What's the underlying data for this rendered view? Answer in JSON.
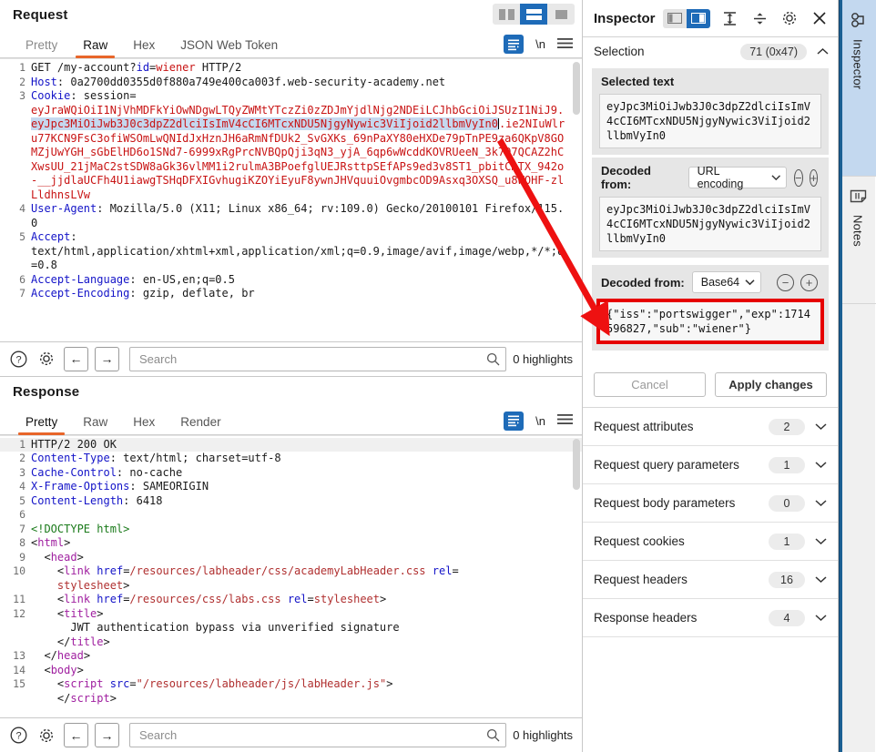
{
  "request": {
    "title": "Request",
    "tabs": [
      {
        "label": "Pretty",
        "active": false
      },
      {
        "label": "Raw",
        "active": true
      },
      {
        "label": "Hex",
        "active": false
      },
      {
        "label": "JSON Web Token",
        "active": false
      }
    ],
    "layout_buttons": [
      "split-vertical",
      "split-horizontal",
      "single-pane"
    ],
    "layout_selected": "split-horizontal",
    "icons": [
      "word-wrap-icon",
      "newline-icon",
      "menu-icon"
    ],
    "newline_label": "\\n",
    "lines": [
      {
        "n": "1",
        "parts": [
          {
            "t": "GET /my-account?",
            "c": ""
          },
          {
            "t": "id",
            "c": "blue"
          },
          {
            "t": "=",
            "c": ""
          },
          {
            "t": "wiener",
            "c": "red"
          },
          {
            "t": " HTTP/2",
            "c": ""
          }
        ]
      },
      {
        "n": "2",
        "parts": [
          {
            "t": "Host",
            "c": "blue"
          },
          {
            "t": ": 0a2700dd0355d0f880a749e400ca003f.web-security-academy.net",
            "c": ""
          }
        ]
      },
      {
        "n": "3",
        "parts": [
          {
            "t": "Cookie",
            "c": "blue"
          },
          {
            "t": ": session=\n",
            "c": ""
          },
          {
            "t": "eyJraWQiOiI1NjVhMDFkYiOwNDgwLTQyZWMtYTczZi0zZDJmYjdlNjg2NDEiLCJhbGciOiJSUzI1NiJ9.",
            "c": "red"
          },
          {
            "t": "eyJpc3MiOiJwb3J0c3dpZ2dlciIsImV4cCI6MTcxNDU5NjgyNywic3ViIjoid2llbmVyIn0",
            "c": "red hl"
          },
          {
            "t": "CARET",
            "c": "caret"
          },
          {
            "t": ".ie2NIuWlru77KCN9FsC3ofiWSOmLwQNIdJxHznJH6aRmNfDUk2_SvGXKs_69nPaXY80eHXDe79pTnPE9za6QKpV8GOMZjUwYGH_sGbElHD6o1SNd7-6999xRgPrcNVBQpQji3qN3_yjA_6qp6wWcddKOVRUeeN_3k7O7QCAZ2hCXwsUU_21jMaC2stSDW8aGk36vlMM1i2rulmA3BPoefglUEJRsttpSEfAPs9ed3v8ST1_pbitCmTX_942o-__jjdlaUCFh4U1iawgTSHqDFXIGvhugiKZOYiEyuF8ywnJHVquuiOvgmbcOD9Asxq3OXSQ_u8WOHF-zlLldhnsLVw",
            "c": "red"
          }
        ]
      },
      {
        "n": "4",
        "parts": [
          {
            "t": "User-Agent",
            "c": "blue"
          },
          {
            "t": ": Mozilla/5.0 (X11; Linux x86_64; rv:109.0) Gecko/20100101 Firefox/115.0",
            "c": ""
          }
        ]
      },
      {
        "n": "5",
        "parts": [
          {
            "t": "Accept",
            "c": "blue"
          },
          {
            "t": ": \ntext/html,application/xhtml+xml,application/xml;q=0.9,image/avif,image/webp,*/*;q=0.8",
            "c": ""
          }
        ]
      },
      {
        "n": "6",
        "parts": [
          {
            "t": "Accept-Language",
            "c": "blue"
          },
          {
            "t": ": en-US,en;q=0.5",
            "c": ""
          }
        ]
      },
      {
        "n": "7",
        "parts": [
          {
            "t": "Accept-Encoding",
            "c": "blue"
          },
          {
            "t": ": gzip, deflate, br",
            "c": ""
          }
        ]
      }
    ],
    "findbar": {
      "search_placeholder": "Search",
      "search_value": "",
      "highlights": "0 highlights",
      "icons": [
        "help-icon",
        "gear-icon",
        "prev-icon",
        "next-icon",
        "search-icon"
      ]
    }
  },
  "response": {
    "title": "Response",
    "tabs": [
      {
        "label": "Pretty",
        "active": true
      },
      {
        "label": "Raw",
        "active": false
      },
      {
        "label": "Hex",
        "active": false
      },
      {
        "label": "Render",
        "active": false
      }
    ],
    "newline_label": "\\n",
    "lines": [
      {
        "n": "1",
        "first": true,
        "parts": [
          {
            "t": "HTTP/2 200 OK",
            "c": ""
          }
        ]
      },
      {
        "n": "2",
        "parts": [
          {
            "t": "Content-Type",
            "c": "blue"
          },
          {
            "t": ": text/html; charset=utf-8",
            "c": ""
          }
        ]
      },
      {
        "n": "3",
        "parts": [
          {
            "t": "Cache-Control",
            "c": "blue"
          },
          {
            "t": ": no-cache",
            "c": ""
          }
        ]
      },
      {
        "n": "4",
        "parts": [
          {
            "t": "X-Frame-Options",
            "c": "blue"
          },
          {
            "t": ": SAMEORIGIN",
            "c": ""
          }
        ]
      },
      {
        "n": "5",
        "parts": [
          {
            "t": "Content-Length",
            "c": "blue"
          },
          {
            "t": ": 6418",
            "c": ""
          }
        ]
      },
      {
        "n": "6",
        "parts": [
          {
            "t": "",
            "c": ""
          }
        ]
      },
      {
        "n": "7",
        "parts": [
          {
            "t": "<!DOCTYPE html>",
            "c": "grn"
          }
        ]
      },
      {
        "n": "8",
        "parts": [
          {
            "t": "<",
            "c": ""
          },
          {
            "t": "html",
            "c": "pur"
          },
          {
            "t": ">",
            "c": ""
          }
        ]
      },
      {
        "n": "9",
        "parts": [
          {
            "t": "  <",
            "c": ""
          },
          {
            "t": "head",
            "c": "pur"
          },
          {
            "t": ">",
            "c": ""
          }
        ]
      },
      {
        "n": "10",
        "parts": [
          {
            "t": "    <",
            "c": ""
          },
          {
            "t": "link",
            "c": "pur"
          },
          {
            "t": " ",
            "c": ""
          },
          {
            "t": "href",
            "c": "blue"
          },
          {
            "t": "=",
            "c": ""
          },
          {
            "t": "/resources/labheader/css/academyLabHeader.css",
            "c": "val"
          },
          {
            "t": " ",
            "c": ""
          },
          {
            "t": "rel",
            "c": "blue"
          },
          {
            "t": "=\n    ",
            "c": ""
          },
          {
            "t": "stylesheet",
            "c": "val"
          },
          {
            "t": ">",
            "c": ""
          }
        ]
      },
      {
        "n": "11",
        "parts": [
          {
            "t": "    <",
            "c": ""
          },
          {
            "t": "link",
            "c": "pur"
          },
          {
            "t": " ",
            "c": ""
          },
          {
            "t": "href",
            "c": "blue"
          },
          {
            "t": "=",
            "c": ""
          },
          {
            "t": "/resources/css/labs.css",
            "c": "val"
          },
          {
            "t": " ",
            "c": ""
          },
          {
            "t": "rel",
            "c": "blue"
          },
          {
            "t": "=",
            "c": ""
          },
          {
            "t": "stylesheet",
            "c": "val"
          },
          {
            "t": ">",
            "c": ""
          }
        ]
      },
      {
        "n": "12",
        "parts": [
          {
            "t": "    <",
            "c": ""
          },
          {
            "t": "title",
            "c": "pur"
          },
          {
            "t": ">\n      JWT authentication bypass via unverified signature\n    </",
            "c": ""
          },
          {
            "t": "title",
            "c": "pur"
          },
          {
            "t": ">",
            "c": ""
          }
        ]
      },
      {
        "n": "13",
        "parts": [
          {
            "t": "  </",
            "c": ""
          },
          {
            "t": "head",
            "c": "pur"
          },
          {
            "t": ">",
            "c": ""
          }
        ]
      },
      {
        "n": "14",
        "parts": [
          {
            "t": "  <",
            "c": ""
          },
          {
            "t": "body",
            "c": "pur"
          },
          {
            "t": ">",
            "c": ""
          }
        ]
      },
      {
        "n": "15",
        "parts": [
          {
            "t": "    <",
            "c": ""
          },
          {
            "t": "script",
            "c": "pur"
          },
          {
            "t": " ",
            "c": ""
          },
          {
            "t": "src",
            "c": "blue"
          },
          {
            "t": "=",
            "c": ""
          },
          {
            "t": "\"/resources/labheader/js/labHeader.js\"",
            "c": "val"
          },
          {
            "t": ">",
            "c": ""
          }
        ]
      },
      {
        "n": "",
        "parts": [
          {
            "t": "    </",
            "c": ""
          },
          {
            "t": "script",
            "c": "pur"
          },
          {
            "t": ">",
            "c": ""
          }
        ]
      }
    ],
    "findbar": {
      "search_placeholder": "Search",
      "search_value": "",
      "highlights": "0 highlights",
      "icons": [
        "help-icon",
        "gear-icon",
        "prev-icon",
        "next-icon",
        "search-icon"
      ]
    }
  },
  "inspector": {
    "title": "Inspector",
    "header_icons": [
      "layout-left-icon",
      "layout-right-icon",
      "expand-all-icon",
      "collapse-all-icon",
      "gear-icon",
      "close-icon"
    ],
    "selection": {
      "label": "Selection",
      "count": "71 (0x47)",
      "chevron": "chevron-up-icon"
    },
    "selected_text": {
      "label": "Selected text",
      "value": "eyJpc3MiOiJwb3J0c3dpZ2dlciIsImV4cCI6MTcxNDU5NjgyNywic3ViIjoid2llbmVyIn0"
    },
    "decoded_url": {
      "label": "Decoded from:",
      "encoding": "URL encoding",
      "value": "eyJpc3MiOiJwb3J0c3dpZ2dlciIsImV4cCI6MTcxNDU5NjgyNywic3ViIjoid2llbmVyIn0"
    },
    "decoded_b64": {
      "label": "Decoded from:",
      "encoding": "Base64",
      "value": "{\"iss\":\"portswigger\",\"exp\":1714596827,\"sub\":\"wiener\"}",
      "minus": "minus-circle-icon",
      "plus": "plus-circle-icon",
      "highlight_color": "#e60000"
    },
    "buttons": {
      "cancel": "Cancel",
      "apply": "Apply changes"
    },
    "accordions": [
      {
        "label": "Request attributes",
        "count": "2"
      },
      {
        "label": "Request query parameters",
        "count": "1"
      },
      {
        "label": "Request body parameters",
        "count": "0"
      },
      {
        "label": "Request cookies",
        "count": "1"
      },
      {
        "label": "Request headers",
        "count": "16"
      },
      {
        "label": "Response headers",
        "count": "4"
      }
    ]
  },
  "rail": {
    "tabs": [
      {
        "label": "Inspector",
        "icon": "inspector-icon",
        "selected": true
      },
      {
        "label": "Notes",
        "icon": "notes-icon",
        "selected": false
      }
    ]
  },
  "annotation": {
    "arrow_color": "#ee1111",
    "highlight_box_color": "#e60000"
  }
}
